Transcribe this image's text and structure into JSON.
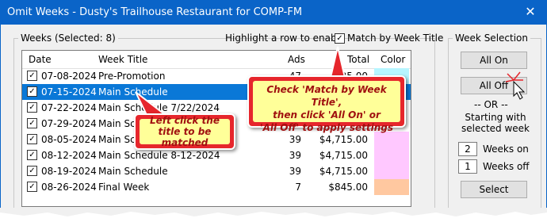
{
  "window": {
    "title": "Omit Weeks - Dusty's Trailhouse Restaurant for COMP-FM",
    "close_glyph": "✕"
  },
  "weeks_group": {
    "label": "Weeks (Selected: 8)",
    "highlight_text": "Highlight a row to enable",
    "match_checkbox_label": "Match by Week Title",
    "match_checked": true
  },
  "table": {
    "columns": [
      "Date",
      "Week Title",
      "Ads",
      "Total",
      "Color"
    ],
    "rows": [
      {
        "date": "07-08-2024",
        "title": "Pre-Promotion",
        "ads": "47",
        "total": "$35.00",
        "color": "#b6f5ff",
        "checked": true,
        "selected": false
      },
      {
        "date": "07-15-2024",
        "title": "Main Schedule",
        "ads": "",
        "total": "",
        "color": "#0a78d7",
        "checked": true,
        "selected": true
      },
      {
        "date": "07-22-2024",
        "title": "Main Schedule 7/22/2024",
        "ads": "",
        "total": "",
        "color": "#ffffff",
        "checked": true,
        "selected": false
      },
      {
        "date": "07-29-2024",
        "title": "Main Sche",
        "ads": "",
        "total": "",
        "color": "#ffffff",
        "checked": true,
        "selected": false
      },
      {
        "date": "08-05-2024",
        "title": "Main Sche",
        "ads": "39",
        "total": "$4,715.00",
        "color": "#ffc8ff",
        "checked": true,
        "selected": false
      },
      {
        "date": "08-12-2024",
        "title": "Main Schedule 8-12-2024",
        "ads": "39",
        "total": "$4,715.00",
        "color": "#ffc8ff",
        "checked": true,
        "selected": false
      },
      {
        "date": "08-19-2024",
        "title": "Main Schedule",
        "ads": "39",
        "total": "$4,715.00",
        "color": "#ffc8ff",
        "checked": true,
        "selected": false
      },
      {
        "date": "08-26-2024",
        "title": "Final Week",
        "ads": "7",
        "total": "$845.00",
        "color": "#ffc8a0",
        "checked": true,
        "selected": false
      }
    ]
  },
  "week_selection": {
    "label": "Week Selection",
    "all_on": "All On",
    "all_off": "All Off",
    "or_text": "-- OR --",
    "starting_text": "Starting with selected week",
    "weeks_on_value": "2",
    "weeks_on_label": "Weeks on",
    "weeks_off_value": "1",
    "weeks_off_label": "Weeks off",
    "select": "Select"
  },
  "callouts": {
    "left": "Left click the title to be matched",
    "right_line1": "Check 'Match by Week Title',",
    "right_line2": "then click 'All On' or",
    "right_line3": "'All Off' to apply settings"
  },
  "colors": {
    "titlebar": "#0a64c8",
    "selection": "#0a78d7",
    "callout_red": "#e6262c"
  }
}
